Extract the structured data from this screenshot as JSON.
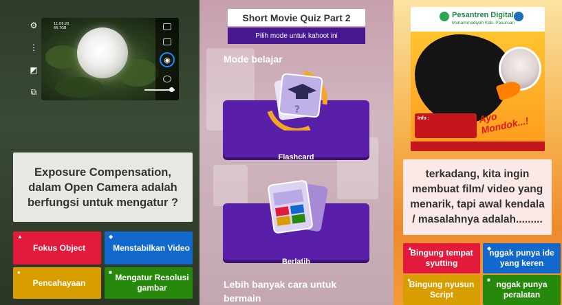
{
  "left": {
    "camera": {
      "timestamp_line1": "11:09:20",
      "timestamp_line2": "66.7GB"
    },
    "question": "Exposure Compensation, dalam Open Camera adalah berfungsi untuk mengatur ?",
    "answers": [
      {
        "label": "Fokus Object",
        "shape": "▲",
        "color": "#e21b3c"
      },
      {
        "label": "Menstabilkan Video",
        "shape": "◆",
        "color": "#1368ce"
      },
      {
        "label": "Pencahayaan",
        "shape": "●",
        "color": "#d89e00"
      },
      {
        "label": "Mengatur Resolusi gambar",
        "shape": "■",
        "color": "#26890c"
      }
    ]
  },
  "middle": {
    "title": "Short Movie Quiz Part 2",
    "subtitle": "Pilih mode untuk kahoot ini",
    "section_label": "Mode belajar",
    "modes": [
      {
        "label": "Flashcard"
      },
      {
        "label": "Berlatih"
      }
    ],
    "more_label": "Lebih banyak cara untuk bermain",
    "accent_color": "#46178f"
  },
  "right": {
    "poster": {
      "title": "Pesantren Digital",
      "subtitle": "Muhammadiyah Kab. Pasuruan",
      "info_label": "Info :",
      "script_text": "Ayo Mondok...!"
    },
    "question": "terkadang, kita ingin membuat film/ video yang menarik, tapi awal kendala / masalahnya adalah.........",
    "answers": [
      {
        "label": "Bingung tempat syutting",
        "shape": "▲",
        "color": "#e21b3c"
      },
      {
        "label": "nggak punya ide yang keren",
        "shape": "◆",
        "color": "#1368ce"
      },
      {
        "label": "Bingung nyusun Script",
        "shape": "●",
        "color": "#d89e00"
      },
      {
        "label": "nggak punya peralatan",
        "shape": "■",
        "color": "#26890c"
      }
    ]
  }
}
